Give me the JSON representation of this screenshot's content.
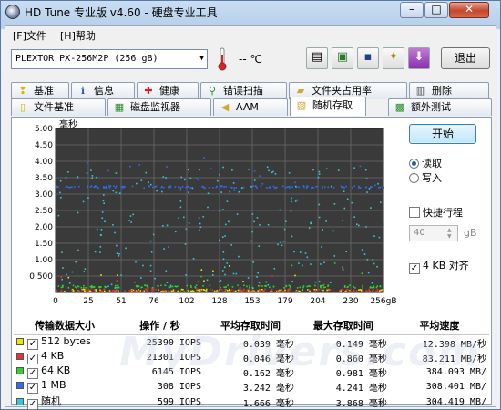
{
  "window": {
    "title": "HD Tune 专业版 v4.60 - 硬盘专业工具",
    "min_label": "–",
    "max_label": "□",
    "close_label": "✕"
  },
  "menu": {
    "file": "[F]文件",
    "help": "[H]帮助"
  },
  "toolbar": {
    "drive": "PLEXTOR  PX-256M2P      (256 gB)",
    "temperature": "-- ℃",
    "exit_label": "退出",
    "icons": [
      "copy-text-icon",
      "copy-screenshot-icon",
      "save-icon",
      "options-icon",
      "download-icon"
    ]
  },
  "tabs_row1": [
    {
      "label": "基准",
      "icon": "lightbulb-icon",
      "color": "#d9b400"
    },
    {
      "label": "信息",
      "icon": "info-icon",
      "color": "#1f5fbf"
    },
    {
      "label": "健康",
      "icon": "health-plus-icon",
      "color": "#d02020"
    },
    {
      "label": "错误扫描",
      "icon": "magnifier-icon",
      "color": "#2a8a2a"
    },
    {
      "label": "文件夹占用率",
      "icon": "folder-icon",
      "color": "#d6a431"
    },
    {
      "label": "删除",
      "icon": "trash-icon",
      "color": "#555555"
    }
  ],
  "tabs_row2": [
    {
      "label": "文件基准",
      "icon": "file-lightbulb-icon",
      "color": "#d9b400"
    },
    {
      "label": "磁盘监视器",
      "icon": "monitor-icon",
      "color": "#2a8a2a"
    },
    {
      "label": "AAM",
      "icon": "speaker-icon",
      "color": "#d6a431"
    },
    {
      "label": "随机存取",
      "icon": "random-access-icon",
      "color": "#d6a431",
      "active": true
    },
    {
      "label": "额外测试",
      "icon": "extra-test-icon",
      "color": "#2a8a2a"
    }
  ],
  "controls": {
    "start_label": "开始",
    "read_label": "读取",
    "write_label": "写入",
    "quick_label": "快捷行程",
    "quick_value": "40",
    "quick_unit": "gB",
    "align_label": "4 KB 对齐",
    "read_selected": true,
    "align_checked": true,
    "quick_checked": false
  },
  "chart_data": {
    "type": "scatter",
    "ylabel": "毫秒",
    "xlabel_unit": "gB",
    "ylim": [
      0,
      5
    ],
    "xlim": [
      0,
      256
    ],
    "y_ticks": [
      "5.00",
      "4.50",
      "4.00",
      "3.50",
      "3.00",
      "2.50",
      "2.00",
      "1.50",
      "1.00",
      "0.500"
    ],
    "x_ticks": [
      "0",
      "25",
      "51",
      "76",
      "102",
      "128",
      "153",
      "179",
      "204",
      "230",
      "256gB"
    ],
    "grid": true,
    "background": "#3a3a3a",
    "series": [
      {
        "name": "512 bytes",
        "color": "#e8e800",
        "band_ms": 0.039
      },
      {
        "name": "4 KB",
        "color": "#e83030",
        "band_ms": 0.046
      },
      {
        "name": "64 KB",
        "color": "#30d030",
        "band_ms": 0.162
      },
      {
        "name": "1 MB",
        "color": "#2f6cf0",
        "band_ms": 3.242
      },
      {
        "name": "随机",
        "color": "#30c8e0",
        "band_ms": 1.666
      }
    ]
  },
  "results": {
    "headers": [
      "传输数据大小",
      "操作 / 秒",
      "平均存取时间",
      "最大存取时间",
      "平均速度"
    ],
    "rows": [
      {
        "size": "512 bytes",
        "color": "#e8e800",
        "ops": "25390 IOPS",
        "avg": "0.039 毫秒",
        "max": "0.149 毫秒",
        "speed": "12.398 MB/秒"
      },
      {
        "size": "4 KB",
        "color": "#e83030",
        "ops": "21301 IOPS",
        "avg": "0.046 毫秒",
        "max": "0.860 毫秒",
        "speed": "83.211 MB/秒"
      },
      {
        "size": "64 KB",
        "color": "#30d030",
        "ops": "6145 IOPS",
        "avg": "0.162 毫秒",
        "max": "0.981 毫秒",
        "speed": "384.093 MB/"
      },
      {
        "size": "1 MB",
        "color": "#2f6cf0",
        "ops": "308 IOPS",
        "avg": "3.242 毫秒",
        "max": "4.241 毫秒",
        "speed": "308.401 MB/"
      },
      {
        "size": "随机",
        "color": "#30c8e0",
        "ops": "599 IOPS",
        "avg": "1.666 毫秒",
        "max": "3.868 毫秒",
        "speed": "304.419 MB/"
      }
    ]
  },
  "watermark": "MyDrivers.com"
}
